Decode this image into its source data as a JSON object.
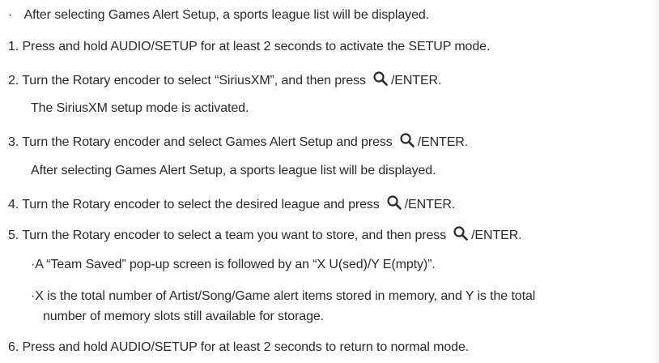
{
  "lines": {
    "l0": {
      "bullet": "·",
      "text": "After selecting Games Alert Setup, a sports league list will be displayed."
    },
    "l1": {
      "num": "1.",
      "text": "Press and hold AUDIO/SETUP for at least 2 seconds to activate the SETUP mode."
    },
    "l2": {
      "num": "2.",
      "text": "Turn the Rotary encoder to select “SiriusXM”, and then press",
      "after": "/ENTER."
    },
    "l3": {
      "text": "The SiriusXM setup mode is activated."
    },
    "l4": {
      "num": "3.",
      "text": "Turn the Rotary encoder and select Games Alert Setup and press",
      "after": "/ENTER."
    },
    "l5": {
      "text": "After selecting Games Alert Setup, a sports league list will be displayed."
    },
    "l6": {
      "num": "4.",
      "text": "Turn the Rotary encoder to select the desired league and press",
      "after": "/ENTER."
    },
    "l7": {
      "num": "5.",
      "text": "Turn the Rotary encoder to select a team you want to store, and then press",
      "after": "/ENTER."
    },
    "l8": {
      "bullet": "·",
      "text": "A “Team Saved” pop-up screen is followed by an “X U(sed)/Y E(mpty)”."
    },
    "l9": {
      "bullet": "·",
      "text": "X is the total number of Artist/Song/Game alert items stored in memory, and Y is the total"
    },
    "l10": {
      "text": "number of memory slots still available for storage."
    },
    "l11": {
      "num": "6.",
      "text": "Press and hold AUDIO/SETUP for at least 2 seconds to return to normal mode."
    }
  },
  "icons": {
    "enter": "magnifier-icon"
  }
}
